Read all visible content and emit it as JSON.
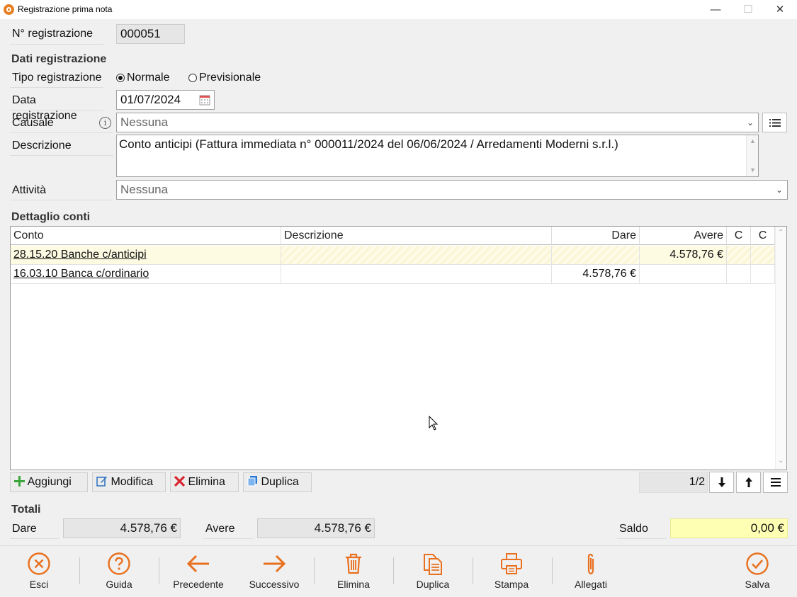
{
  "window": {
    "title": "Registrazione prima nota",
    "minimize": "—",
    "maximize": "☐",
    "close": "✕"
  },
  "header": {
    "numero_label": "N° registrazione",
    "numero_value": "000051"
  },
  "dati": {
    "section": "Dati registrazione",
    "tipo_label": "Tipo registrazione",
    "tipo_options": [
      "Normale",
      "Previsionale"
    ],
    "tipo_selected": "Normale",
    "data_label": "Data registrazione",
    "data_value": "01/07/2024",
    "causale_label": "Causale",
    "causale_value": "Nessuna",
    "descrizione_label": "Descrizione",
    "descrizione_value": "Conto anticipi (Fattura immediata n° 000011/2024 del 06/06/2024 / Arredamenti Moderni s.r.l.)",
    "attivita_label": "Attività",
    "attivita_value": "Nessuna"
  },
  "dettaglio": {
    "section": "Dettaglio conti",
    "columns": [
      "Conto",
      "Descrizione",
      "Dare",
      "Avere",
      "C",
      "C"
    ],
    "rows": [
      {
        "conto": "28.15.20 Banche c/anticipi",
        "descrizione": "",
        "dare": "",
        "avere": "4.578,76 €",
        "c1": "",
        "c2": ""
      },
      {
        "conto": "16.03.10 Banca c/ordinario",
        "descrizione": "",
        "dare": "4.578,76 €",
        "avere": "",
        "c1": "",
        "c2": ""
      }
    ],
    "buttons": {
      "aggiungi": "Aggiungi",
      "modifica": "Modifica",
      "elimina": "Elimina",
      "duplica": "Duplica"
    },
    "page": "1/2"
  },
  "totali": {
    "section": "Totali",
    "dare_label": "Dare",
    "dare_value": "4.578,76 €",
    "avere_label": "Avere",
    "avere_value": "4.578,76 €",
    "saldo_label": "Saldo",
    "saldo_value": "0,00 €"
  },
  "footer": {
    "esci": "Esci",
    "guida": "Guida",
    "precedente": "Precedente",
    "successivo": "Successivo",
    "elimina": "Elimina",
    "duplica": "Duplica",
    "stampa": "Stampa",
    "allegati": "Allegati",
    "salva": "Salva"
  },
  "colors": {
    "accent": "#e8701e",
    "saldo_bg": "#ffffb4",
    "selected_row": "#fefbe3"
  }
}
